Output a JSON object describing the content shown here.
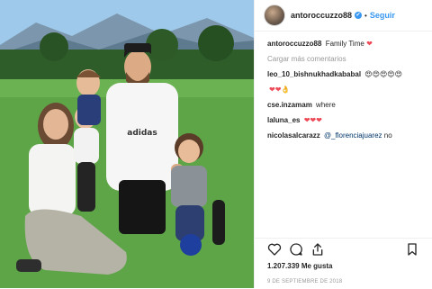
{
  "post": {
    "photo_alt": "Family photo on a grass field"
  },
  "header": {
    "username": "antoroccuzzo88",
    "verified_mark": "✔",
    "separator": "•",
    "follow_label": "Seguir"
  },
  "caption": {
    "username": "antoroccuzzo88",
    "text": "Family Time",
    "emoji": "❤"
  },
  "load_more_label": "Cargar más comentarios",
  "comments": [
    {
      "username": "leo_10_bishnukhadkababal",
      "text": "😍😍😍😍😍"
    },
    {
      "username": "",
      "text": "❤❤👌"
    },
    {
      "username": "cse.inzamam",
      "text": "where"
    },
    {
      "username": "laluna_es",
      "text": "❤❤❤"
    },
    {
      "username": "nicolasalcarazz",
      "mention": "@_florenciajuarez",
      "text": "no"
    }
  ],
  "actions": {
    "icons": [
      "heart-icon",
      "comment-icon",
      "share-icon",
      "bookmark-icon"
    ],
    "likes_count": "1.207.339",
    "likes_label": "Me gusta",
    "date": "9 DE SEPTIEMBRE DE 2018"
  },
  "colors": {
    "accent": "#3897f0",
    "text": "#262626",
    "muted": "#999999",
    "border": "#efefef"
  }
}
